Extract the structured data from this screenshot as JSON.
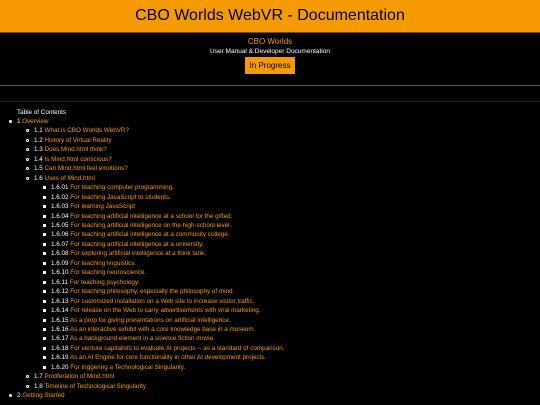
{
  "header": {
    "title": "CBO Worlds WebVR - Documentation"
  },
  "intro": {
    "org": "CBO Worlds",
    "subtitle": "User Manual & Developer Documentation",
    "status_button": "In Progress"
  },
  "toc": {
    "title": "Table of Contents",
    "sections": [
      {
        "num": "1",
        "label": "Overview",
        "items": [
          {
            "num": "1.1",
            "label": "What is CBO Worlds WebVR?"
          },
          {
            "num": "1.2",
            "label": "History of Virtual Reality"
          },
          {
            "num": "1.3",
            "label": "Does Mind.html think?"
          },
          {
            "num": "1.4",
            "label": "Is Mind.html conscious?"
          },
          {
            "num": "1.5",
            "label": "Can Mind.html feel emotions?"
          },
          {
            "num": "1.6",
            "label": "Uses of Mind.html",
            "items": [
              {
                "num": "1.6.01",
                "label": "For teaching computer programming."
              },
              {
                "num": "1.6.02",
                "label": "For teaching JavaScript to students."
              },
              {
                "num": "1.6.03",
                "label": "For learning JavaScript"
              },
              {
                "num": "1.6.04",
                "label": "For teaching artificial intelligence at a school for the gifted."
              },
              {
                "num": "1.6.05",
                "label": "For teaching artificial intelligence on the high-school level."
              },
              {
                "num": "1.6.06",
                "label": "For teaching artificial intelligence at a community college."
              },
              {
                "num": "1.6.07",
                "label": "For teaching artificial intelligence at a university."
              },
              {
                "num": "1.6.08",
                "label": "For exploring artificial intelligence at a think tank."
              },
              {
                "num": "1.6.09",
                "label": "For teaching linguistics."
              },
              {
                "num": "1.6.10",
                "label": "For teaching neuroscience."
              },
              {
                "num": "1.6.11",
                "label": "For teaching psychology."
              },
              {
                "num": "1.6.12",
                "label": "For teaching philosophy, especially the philosophy of mind."
              },
              {
                "num": "1.6.13",
                "label": "For customized installation on a Web site to increase visitor traffic."
              },
              {
                "num": "1.6.14",
                "label": "For release on the Web to carry advertisements with viral marketing."
              },
              {
                "num": "1.6.15",
                "label": "As a prop for giving presentations on artificial intelligence."
              },
              {
                "num": "1.6.16",
                "label": "As an interactive exhibit with a core knowledge base in a museum."
              },
              {
                "num": "1.6.17",
                "label": "As a background element in a science fiction movie."
              },
              {
                "num": "1.6.18",
                "label": "For venture capitalists to evaluate AI projects -- as a standard of comparison."
              },
              {
                "num": "1.6.19",
                "label": "As an AI Engine for core functionality in other AI development projects."
              },
              {
                "num": "1.6.20",
                "label": "For triggering a Technological Singularity."
              }
            ]
          },
          {
            "num": "1.7",
            "label": "Proliferation of Mind.html"
          },
          {
            "num": "1.8",
            "label": "Timeline of Technological Singularity"
          }
        ]
      },
      {
        "num": "2",
        "label": "Getting Started",
        "items": []
      }
    ]
  }
}
